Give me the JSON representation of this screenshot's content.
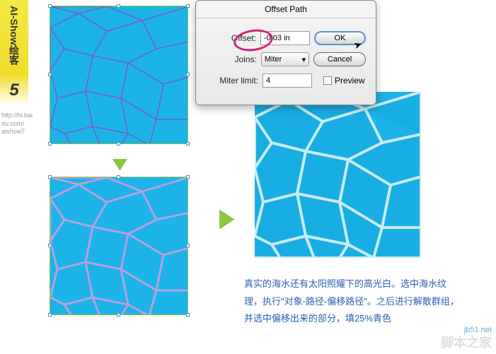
{
  "step": {
    "label": "AI-Show绘客",
    "number": "5"
  },
  "url": "http://hi.bai\ndu.com/\naishow7",
  "dialog": {
    "title": "Offset Path",
    "offset_label": "Offset:",
    "offset_value": "-0.03 in",
    "joins_label": "Joins:",
    "joins_value": "Miter",
    "miter_label": "Miter limit:",
    "miter_value": "4",
    "ok": "OK",
    "cancel": "Cancel",
    "preview": "Preview"
  },
  "description": "真实的海水还有太阳照耀下的高光白。选中海水纹理，执行\"对象-路径-偏移路径\"。之后进行解散群组，并选中偏移出来的部分，填25%青色",
  "watermark": {
    "main": "脚本之家",
    "sub": "jb51.net"
  }
}
